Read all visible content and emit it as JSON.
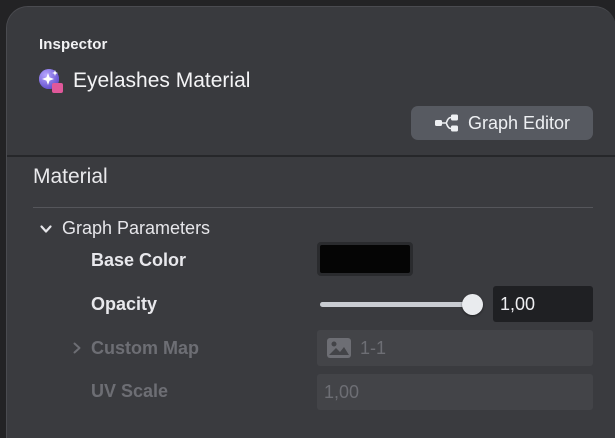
{
  "inspector": {
    "heading": "Inspector",
    "title": "Eyelashes Material",
    "title_icon": "material-sparkle-icon",
    "graph_editor_label": "Graph Editor",
    "graph_editor_icon": "node-graph-icon"
  },
  "material": {
    "section_title": "Material",
    "group_label": "Graph Parameters",
    "group_expanded": true,
    "rows": {
      "base_color": {
        "label": "Base Color",
        "value_hex": "#050505"
      },
      "opacity": {
        "label": "Opacity",
        "value": "1,00",
        "slider_fraction": 1.0
      },
      "custom_map": {
        "label": "Custom Map",
        "value": "1-1",
        "enabled": false,
        "expanded": false
      },
      "uv_scale": {
        "label": "UV Scale",
        "value": "1,00",
        "enabled": false
      }
    }
  },
  "colors": {
    "panel_bg": "#3a3b3f",
    "button_bg": "#575a61",
    "field_bg": "#1f2023",
    "disabled_text": "#6d6e74",
    "icon_purple": "#8a6cf0",
    "icon_pink": "#e0589a"
  }
}
